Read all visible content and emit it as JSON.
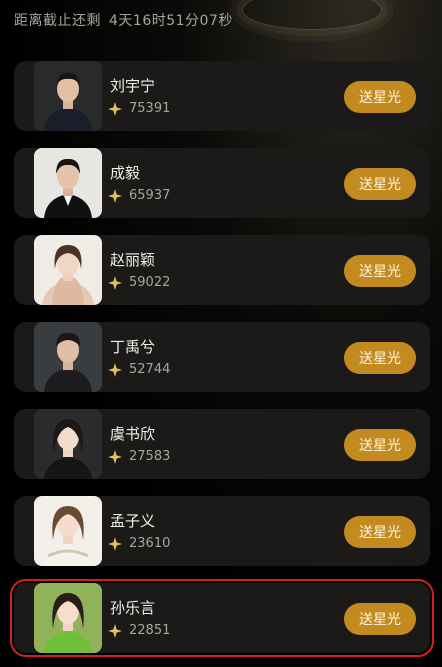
{
  "header": {
    "countdown_label": "距离截止还剩",
    "countdown_time": "4天16时51分07秒"
  },
  "colors": {
    "button": "#c28a1f",
    "card": "#1b1a19",
    "highlight_border": "#d0201f",
    "accent_spark": "#e5c25a"
  },
  "icons": {
    "score": "four-point-sparkle-icon"
  },
  "candidates": [
    {
      "name": "刘宇宁",
      "score": "75391",
      "button": "送星光"
    },
    {
      "name": "成毅",
      "score": "65937",
      "button": "送星光"
    },
    {
      "name": "赵丽颖",
      "score": "59022",
      "button": "送星光"
    },
    {
      "name": "丁禹兮",
      "score": "52744",
      "button": "送星光"
    },
    {
      "name": "虞书欣",
      "score": "27583",
      "button": "送星光"
    },
    {
      "name": "孟子义",
      "score": "23610",
      "button": "送星光"
    },
    {
      "name": "孙乐言",
      "score": "22851",
      "button": "送星光",
      "highlighted": true
    }
  ]
}
